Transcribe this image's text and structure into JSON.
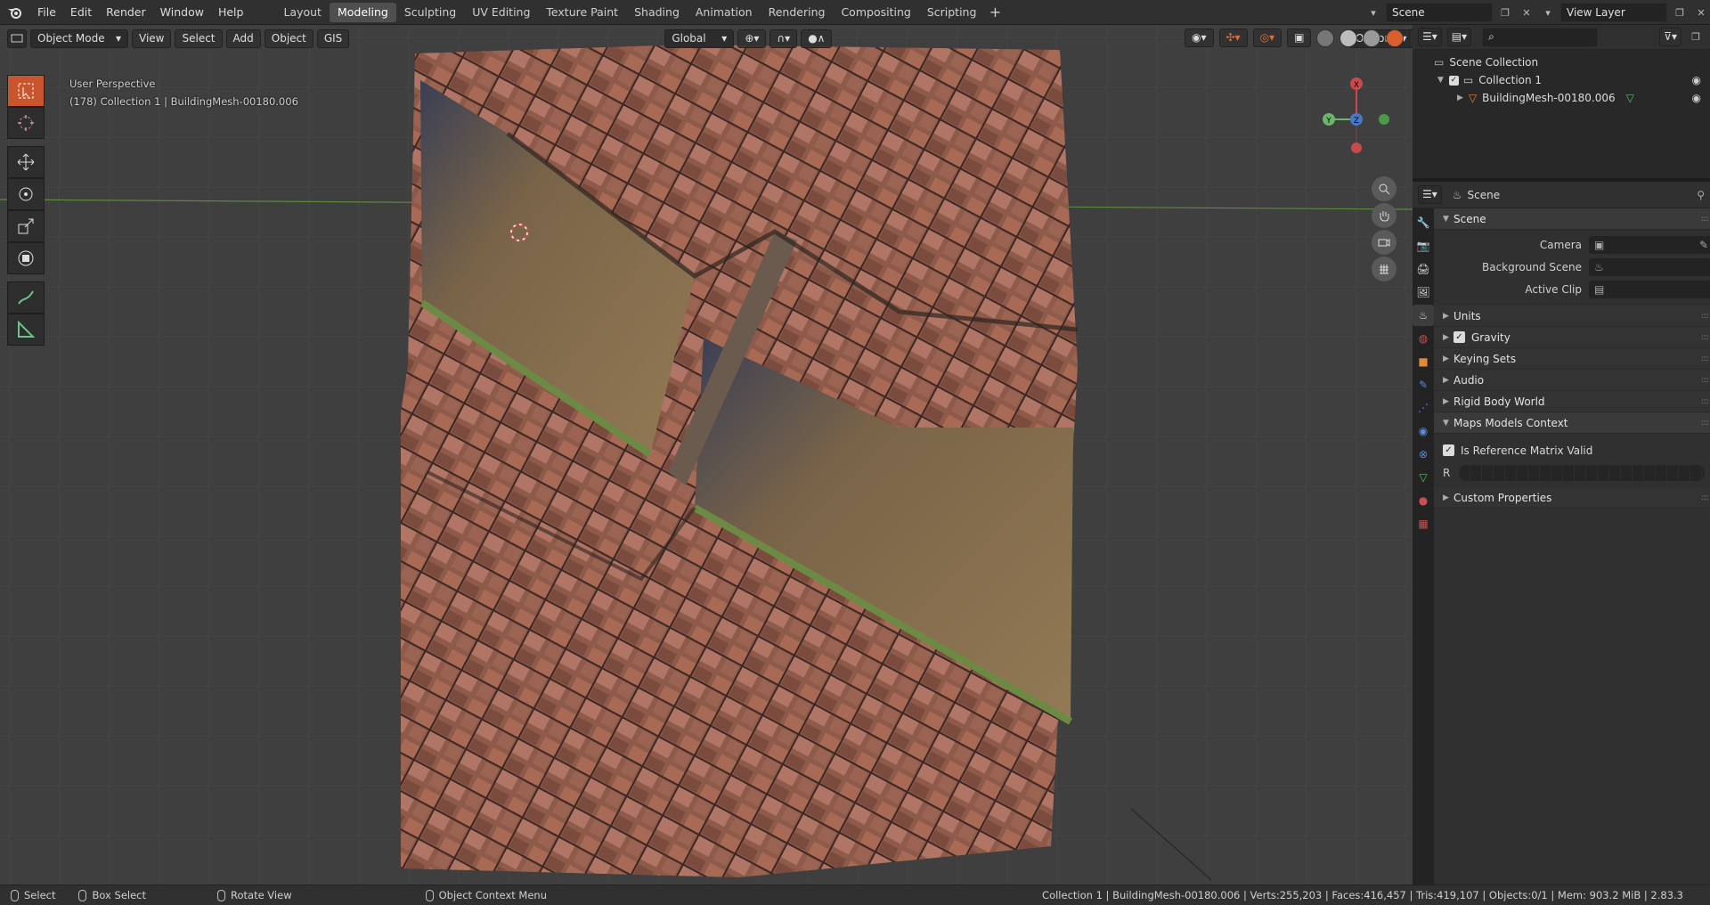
{
  "menu": [
    "File",
    "Edit",
    "Render",
    "Window",
    "Help"
  ],
  "workspaces": [
    {
      "label": "Layout",
      "active": false
    },
    {
      "label": "Modeling",
      "active": true
    },
    {
      "label": "Sculpting",
      "active": false
    },
    {
      "label": "UV Editing",
      "active": false
    },
    {
      "label": "Texture Paint",
      "active": false
    },
    {
      "label": "Shading",
      "active": false
    },
    {
      "label": "Animation",
      "active": false
    },
    {
      "label": "Rendering",
      "active": false
    },
    {
      "label": "Compositing",
      "active": false
    },
    {
      "label": "Scripting",
      "active": false
    }
  ],
  "topbar": {
    "scene": "Scene",
    "view_layer": "View Layer"
  },
  "viewport": {
    "mode": "Object Mode",
    "header_menus": [
      "View",
      "Select",
      "Add",
      "Object",
      "GIS"
    ],
    "transform_orientation": "Global",
    "options_label": "Options",
    "info_line1": "User Perspective",
    "info_line2": "(178) Collection 1 | BuildingMesh-00180.006",
    "gizmo": {
      "x": "X",
      "y": "Y",
      "z": "Z"
    }
  },
  "outliner": {
    "root": "Scene Collection",
    "collection": "Collection 1",
    "object": "BuildingMesh-00180.006"
  },
  "properties": {
    "context": "Scene",
    "scene_panel": "Scene",
    "camera_label": "Camera",
    "background_scene_label": "Background Scene",
    "active_clip_label": "Active Clip",
    "panels": [
      "Units",
      "Gravity",
      "Keying Sets",
      "Audio",
      "Rigid Body World",
      "Maps Models Context"
    ],
    "is_reference_label": "Is Reference Matrix Valid",
    "r_label": "R",
    "custom_props": "Custom Properties"
  },
  "status": {
    "select": "Select",
    "box_select": "Box Select",
    "rotate_view": "Rotate View",
    "context_menu": "Object Context Menu",
    "stats": "Collection 1 | BuildingMesh-00180.006 | Verts:255,203 | Faces:416,457 | Tris:419,107 | Objects:0/1 | Mem: 903.2 MiB | 2.83.3"
  }
}
